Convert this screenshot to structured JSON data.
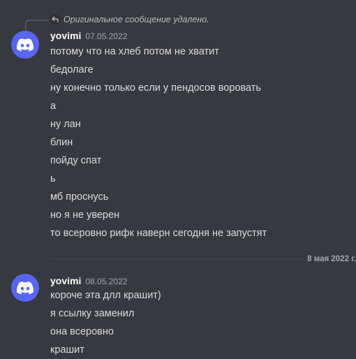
{
  "reply": {
    "text": "Оригинальное сообщение удалено."
  },
  "groups": [
    {
      "username": "yovimi",
      "timestamp": "07.05.2022",
      "avatar_icon": "discord-logo-icon",
      "lines": [
        "потому что на хлеб потом не хватит",
        "бедолаге",
        "ну конечно только если у пендосов воровать",
        "а",
        "ну лан",
        "блин",
        "пойду спат",
        "ь",
        "мб проснусь",
        "но я не уверен",
        "то всеровно рифк наверн сегодня не запустят"
      ]
    },
    {
      "username": "yovimi",
      "timestamp": "08.05.2022",
      "avatar_icon": "discord-logo-icon",
      "lines": [
        "короче эта длл крашит)",
        "я ссылку заменил",
        "она всеровно",
        "крашит"
      ]
    }
  ],
  "date_divider": "8 мая 2022 г.",
  "colors": {
    "background": "#36393f",
    "avatar": "#5865f2",
    "text": "#dcddde",
    "username": "#ffffff",
    "muted": "#a3a6aa"
  }
}
